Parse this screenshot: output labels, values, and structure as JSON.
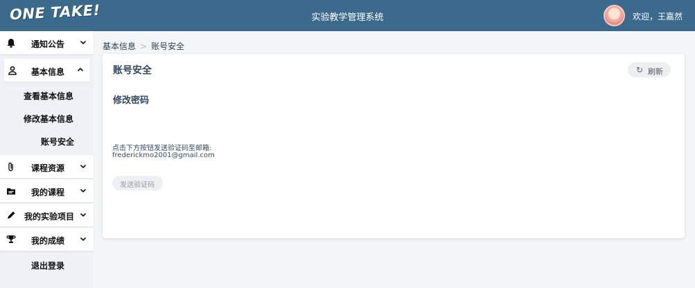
{
  "header": {
    "logo": "ONE TAKE!",
    "title": "实验教学管理系统",
    "welcome": "欢迎，王嘉然"
  },
  "sidebar": {
    "items": [
      {
        "label": "通知公告",
        "icon": "bell-icon"
      },
      {
        "label": "基本信息",
        "icon": "user-icon"
      },
      {
        "label": "课程资源",
        "icon": "paperclip-icon"
      },
      {
        "label": "我的课程",
        "icon": "folder-icon"
      },
      {
        "label": "我的实验项目",
        "icon": "pencil-icon"
      },
      {
        "label": "我的成绩",
        "icon": "trophy-icon"
      }
    ],
    "subitems": [
      "查看基本信息",
      "修改基本信息",
      "账号安全"
    ],
    "logout": "退出登录"
  },
  "breadcrumb": {
    "parent": "基本信息",
    "separator": ">",
    "current": "账号安全"
  },
  "card": {
    "title": "账号安全",
    "refresh": "刷新",
    "section_title": "修改密码",
    "hint": "点击下方按钮发送验证码至邮箱:",
    "email": "frederickmo2001@gmail.com",
    "send_button": "发送验证码"
  }
}
